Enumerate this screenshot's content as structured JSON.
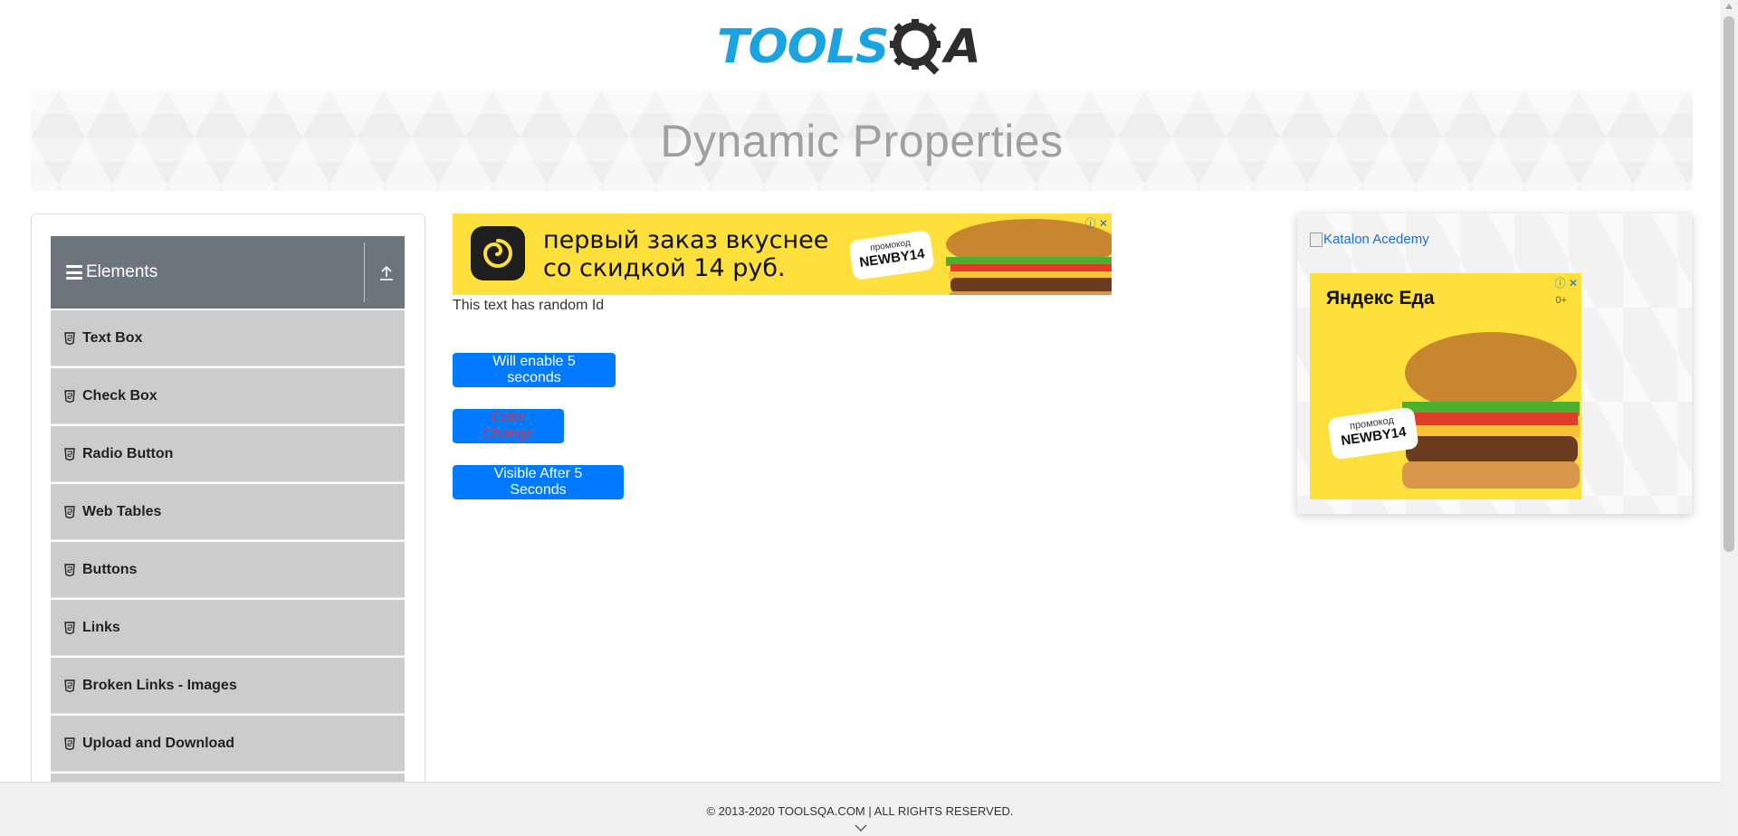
{
  "header": {
    "logo_part1": "TOOLS",
    "logo_part2": "A"
  },
  "banner": {
    "title": "Dynamic Properties"
  },
  "sidebar": {
    "group_title": "Elements",
    "items": [
      {
        "label": "Text Box"
      },
      {
        "label": "Check Box"
      },
      {
        "label": "Radio Button"
      },
      {
        "label": "Web Tables"
      },
      {
        "label": "Buttons"
      },
      {
        "label": "Links"
      },
      {
        "label": "Broken Links - Images"
      },
      {
        "label": "Upload and Download"
      }
    ]
  },
  "ad_top": {
    "text_line1": "первый заказ вкуснее",
    "text_line2": "со скидкой 14 руб.",
    "promo_label": "промокод",
    "promo_code": "NEWBY14"
  },
  "main": {
    "random_id_text": "This text has random Id",
    "enable_button": "Will enable 5 seconds",
    "color_button": "Color Change",
    "visible_button": "Visible After 5 Seconds"
  },
  "ad_right": {
    "katalon_alt": "Katalon Acedemy",
    "brand": "Яндекс Еда",
    "age": "0+",
    "promo_label": "промокод",
    "promo_code": "NEWBY14"
  },
  "footer": {
    "copyright": "© 2013-2020 TOOLSQA.COM | ALL RIGHTS RESERVED."
  },
  "colors": {
    "primary_button": "#007bff",
    "color_change_text": "#dc3545",
    "sidebar_header": "#6c757d",
    "logo_blue": "#1aa3e0"
  }
}
